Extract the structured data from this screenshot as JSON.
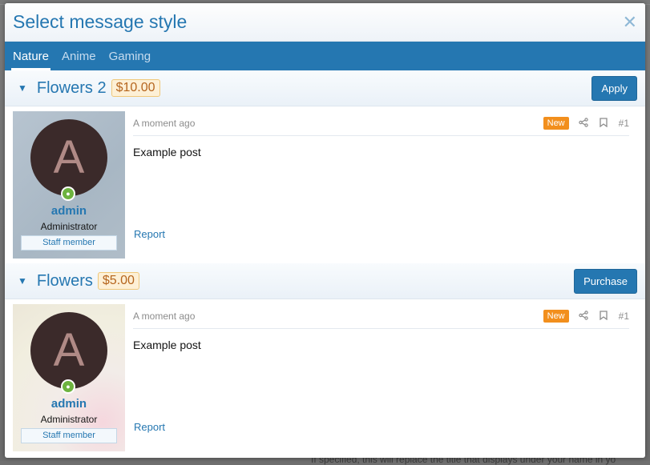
{
  "background": {
    "text": "If specified, this will replace the title that displays under your name in yo"
  },
  "modal": {
    "title": "Select message style"
  },
  "tabs": [
    {
      "label": "Nature"
    },
    {
      "label": "Anime"
    },
    {
      "label": "Gaming"
    }
  ],
  "styles": [
    {
      "title": "Flowers 2",
      "price": "$10.00",
      "action": "Apply",
      "post": {
        "avatar_letter": "A",
        "username": "admin",
        "user_title": "Administrator",
        "banner": "Staff member",
        "time": "A moment ago",
        "badge": "New",
        "post_number": "#1",
        "body": "Example post",
        "report": "Report"
      }
    },
    {
      "title": "Flowers",
      "price": "$5.00",
      "action": "Purchase",
      "post": {
        "avatar_letter": "A",
        "username": "admin",
        "user_title": "Administrator",
        "banner": "Staff member",
        "time": "A moment ago",
        "badge": "New",
        "post_number": "#1",
        "body": "Example post",
        "report": "Report"
      }
    }
  ],
  "icons": {
    "close": "✕",
    "caret": "▼",
    "share": "⋖",
    "bookmark": "🔖",
    "online": "●"
  },
  "colors": {
    "accent": "#2577b1",
    "badge": "#f28f1d",
    "price_text": "#b5651d"
  }
}
